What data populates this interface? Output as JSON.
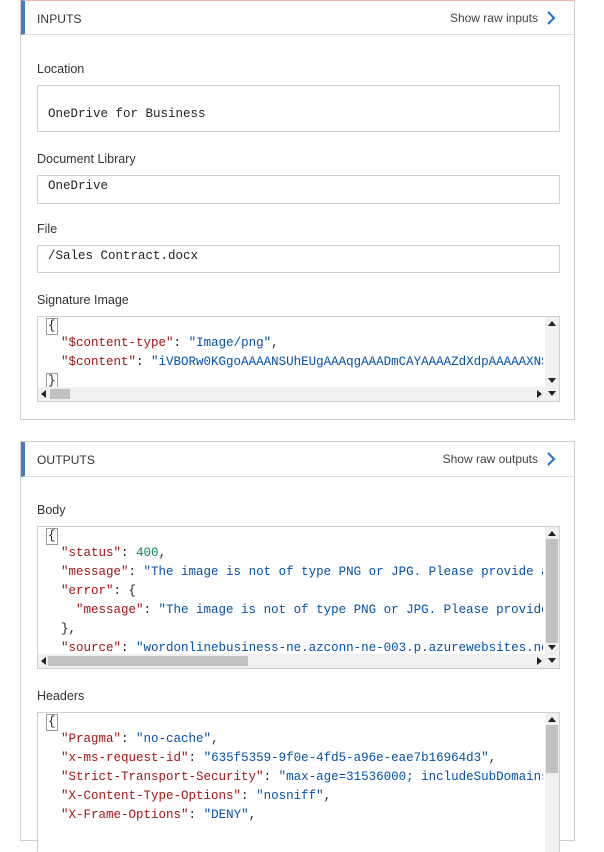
{
  "inputs": {
    "title": "INPUTS",
    "raw_link": "Show raw inputs",
    "location": {
      "label": "Location",
      "value": "OneDrive for Business"
    },
    "library": {
      "label": "Document Library",
      "value": "OneDrive"
    },
    "file": {
      "label": "File",
      "value": "/Sales Contract.docx"
    },
    "signature": {
      "label": "Signature Image",
      "open": "{",
      "close": "}",
      "lines": [
        {
          "key": "\"$content-type\"",
          "sep": ": ",
          "val": "\"Image/png\"",
          "tail": ","
        },
        {
          "key": "\"$content\"",
          "sep": ": ",
          "val": "\"iVBORw0KGgoAAAANSUhEUgAAAqgAAADmCAYAAAAZdXdpAAAAAXNS",
          "tail": ""
        }
      ]
    }
  },
  "outputs": {
    "title": "OUTPUTS",
    "raw_link": "Show raw outputs",
    "body": {
      "label": "Body",
      "open": "{",
      "lines": [
        {
          "indent": "  ",
          "key": "\"status\"",
          "sep": ": ",
          "num": "400",
          "tail": ","
        },
        {
          "indent": "  ",
          "key": "\"message\"",
          "sep": ": ",
          "val": "\"The image is not of type PNG or JPG. Please provide a",
          "tail": ""
        },
        {
          "indent": "  ",
          "key": "\"error\"",
          "sep": ": ",
          "tail": "{"
        },
        {
          "indent": "    ",
          "key": "\"message\"",
          "sep": ": ",
          "val": "\"The image is not of type PNG or JPG. Please provide",
          "tail": ""
        },
        {
          "indent": "  ",
          "tail": "},"
        },
        {
          "indent": "  ",
          "key": "\"source\"",
          "sep": ": ",
          "val": "\"wordonlinebusiness-ne.azconn-ne-003.p.azurewebsites.ne",
          "tail": ""
        }
      ]
    },
    "headers": {
      "label": "Headers",
      "open": "{",
      "lines": [
        {
          "key": "\"Pragma\"",
          "sep": ": ",
          "val": "\"no-cache\"",
          "tail": ","
        },
        {
          "key": "\"x-ms-request-id\"",
          "sep": ": ",
          "val": "\"635f5359-9f0e-4fd5-a96e-eae7b16964d3\"",
          "tail": ","
        },
        {
          "key": "\"Strict-Transport-Security\"",
          "sep": ": ",
          "val": "\"max-age=31536000; includeSubDomains",
          "tail": ""
        },
        {
          "key": "\"X-Content-Type-Options\"",
          "sep": ": ",
          "val": "\"nosniff\"",
          "tail": ","
        },
        {
          "key": "\"X-Frame-Options\"",
          "sep": ": ",
          "val": "\"DENY\"",
          "tail": ","
        }
      ]
    }
  },
  "colors": {
    "accent": "#4a7bc1",
    "key": "#a31515",
    "string": "#0451a5",
    "number": "#098658",
    "link_chevron": "#1f6fd0"
  },
  "icons": {
    "raw_link": "chevron-right-icon"
  }
}
